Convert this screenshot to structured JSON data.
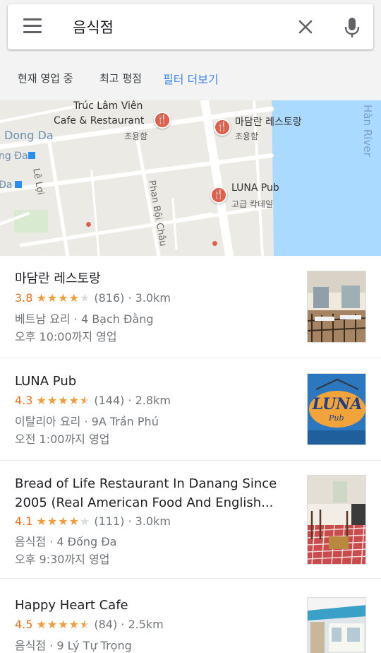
{
  "search": {
    "query": "음식점"
  },
  "filters": [
    {
      "label": "현재 영업 중"
    },
    {
      "label": "최고 평점"
    },
    {
      "label": "필터 더보기"
    }
  ],
  "map": {
    "pois": [
      {
        "name_line1": "Trúc Lâm Viên",
        "name_line2": "Cafe & Restaurant",
        "sub": "조용함"
      },
      {
        "name": "마담란 레스토랑",
        "sub": "조용함"
      },
      {
        "name": "LUNA Pub",
        "sub": "고급 칵테일"
      }
    ],
    "areas": [
      "Dong Da",
      "ng Đa",
      "Đa"
    ],
    "streets": [
      "Lê Lợi",
      "Phan Bội Châu"
    ],
    "river": "Hàn River",
    "colors": {
      "land": "#eceae5",
      "water": "#aadaff",
      "road": "#ffffff",
      "pin": "#e15f4a"
    }
  },
  "results": [
    {
      "name": "마담란 레스토랑",
      "rating": "3.8",
      "stars": {
        "full": "★★★★",
        "empty": "★"
      },
      "reviews": "(816) · 3.0km",
      "details": "베트남 요리 · 4 Bạch Đằng",
      "hours": "오후 10:00까지 영업"
    },
    {
      "name": "LUNA Pub",
      "rating": "4.3",
      "stars": {
        "full": "★★★★",
        "half": "★",
        "empty": ""
      },
      "reviews": "(144) · 2.8km",
      "details": "이탈리아 요리 · 9A Trần Phú",
      "hours": "오전 1:00까지 영업",
      "thumb_text": "LUNA",
      "thumb_sub": "Pub"
    },
    {
      "name_line1": "Bread of Life Restaurant In Danang Since",
      "name_line2": "2005 (Real American Food And English...",
      "rating": "4.1",
      "stars": {
        "full": "★★★★",
        "empty": "★"
      },
      "reviews": "(111) · 3.0km",
      "details": "음식점 · 4 Đống Đa",
      "hours": "오후 9:30까지 영업"
    },
    {
      "name": "Happy Heart Cafe",
      "rating": "4.5",
      "stars": {
        "full": "★★★★",
        "half": "★",
        "empty": ""
      },
      "reviews": "(84) · 2.5km",
      "details": "음식점 · 9 Lý Tự Trọng"
    }
  ]
}
